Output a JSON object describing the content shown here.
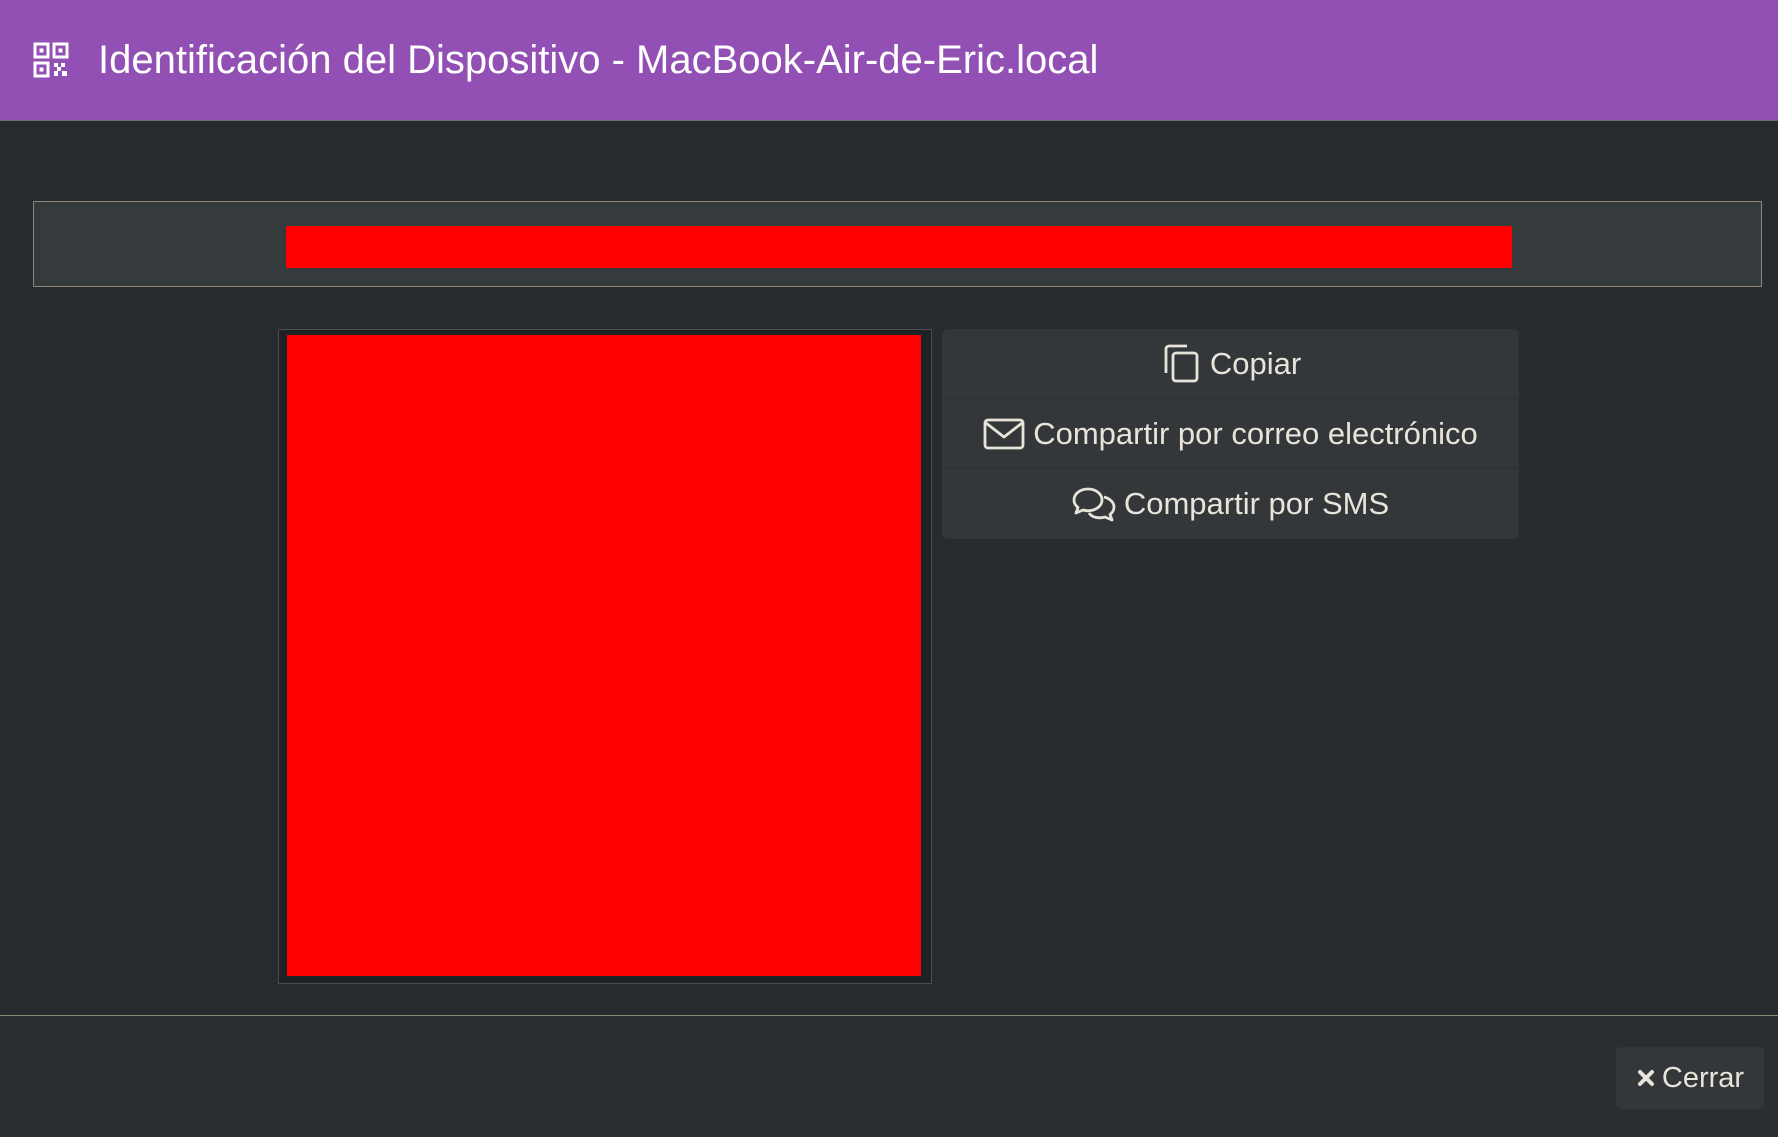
{
  "dialog": {
    "title": "Identificación del Dispositivo - MacBook-Air-de-Eric.local",
    "header_icon": "qrcode-icon",
    "header_color": "#9350b4"
  },
  "device_id": {
    "value": "",
    "redaction_color": "#ff0000"
  },
  "qr": {
    "icon": "qr-code-image",
    "redaction_color": "#ff0000"
  },
  "actions": [
    {
      "label": "Copiar",
      "icon": "copy-icon"
    },
    {
      "label": "Compartir por correo electrónico",
      "icon": "envelope-icon"
    },
    {
      "label": "Compartir por SMS",
      "icon": "comments-icon"
    }
  ],
  "footer": {
    "close_label": "Cerrar",
    "close_icon": "close-icon"
  }
}
